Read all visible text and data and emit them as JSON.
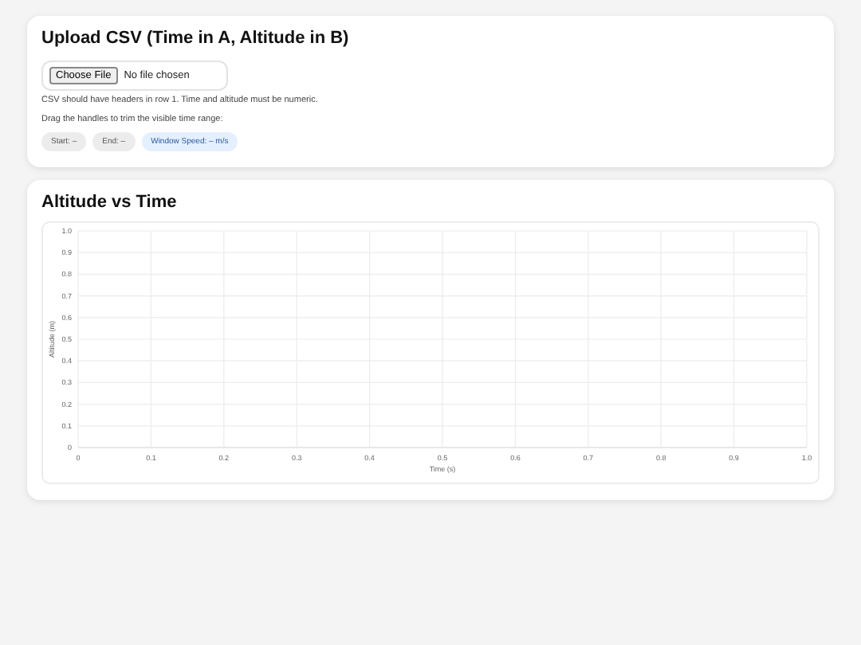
{
  "upload": {
    "title": "Upload CSV (Time in A, Altitude in B)",
    "file_button": "Choose File",
    "file_status": "No file chosen",
    "hint": "CSV should have headers in row 1. Time and altitude must be numeric.",
    "trim_hint": "Drag the handles to trim the visible time range:",
    "chips": [
      {
        "label": "Start: –",
        "kind": "neutral"
      },
      {
        "label": "End: –",
        "kind": "neutral"
      },
      {
        "label": "Window Speed: – m/s",
        "kind": "info"
      }
    ]
  },
  "chart": {
    "title": "Altitude vs Time",
    "chart_data": {
      "type": "line",
      "grid": true,
      "xlabel": "Time (s)",
      "ylabel": "Altitude (m)",
      "xlim": [
        0,
        1
      ],
      "ylim": [
        0,
        1
      ],
      "xticks": [
        0,
        {
          "value": 0.1,
          "label": "0.1"
        },
        {
          "value": 0.2,
          "label": "0.2"
        },
        {
          "value": 0.3,
          "label": "0.3"
        },
        {
          "value": 0.4,
          "label": "0.4"
        },
        {
          "value": 0.5,
          "label": "0.5"
        },
        {
          "value": 0.6,
          "label": "0.6"
        },
        {
          "value": 0.7,
          "label": "0.7"
        },
        {
          "value": 0.8,
          "label": "0.8"
        },
        {
          "value": 0.9,
          "label": "0.9"
        },
        {
          "value": 1,
          "label": "1.0"
        }
      ],
      "yticks": [
        0,
        {
          "value": 0.1,
          "label": "0.1"
        },
        {
          "value": 0.2,
          "label": "0.2"
        },
        {
          "value": 0.3,
          "label": "0.3"
        },
        {
          "value": 0.4,
          "label": "0.4"
        },
        {
          "value": 0.5,
          "label": "0.5"
        },
        {
          "value": 0.6,
          "label": "0.6"
        },
        {
          "value": 0.7,
          "label": "0.7"
        },
        {
          "value": 0.8,
          "label": "0.8"
        },
        {
          "value": 0.9,
          "label": "0.9"
        },
        {
          "value": 1,
          "label": "1.0"
        }
      ]
    }
  }
}
